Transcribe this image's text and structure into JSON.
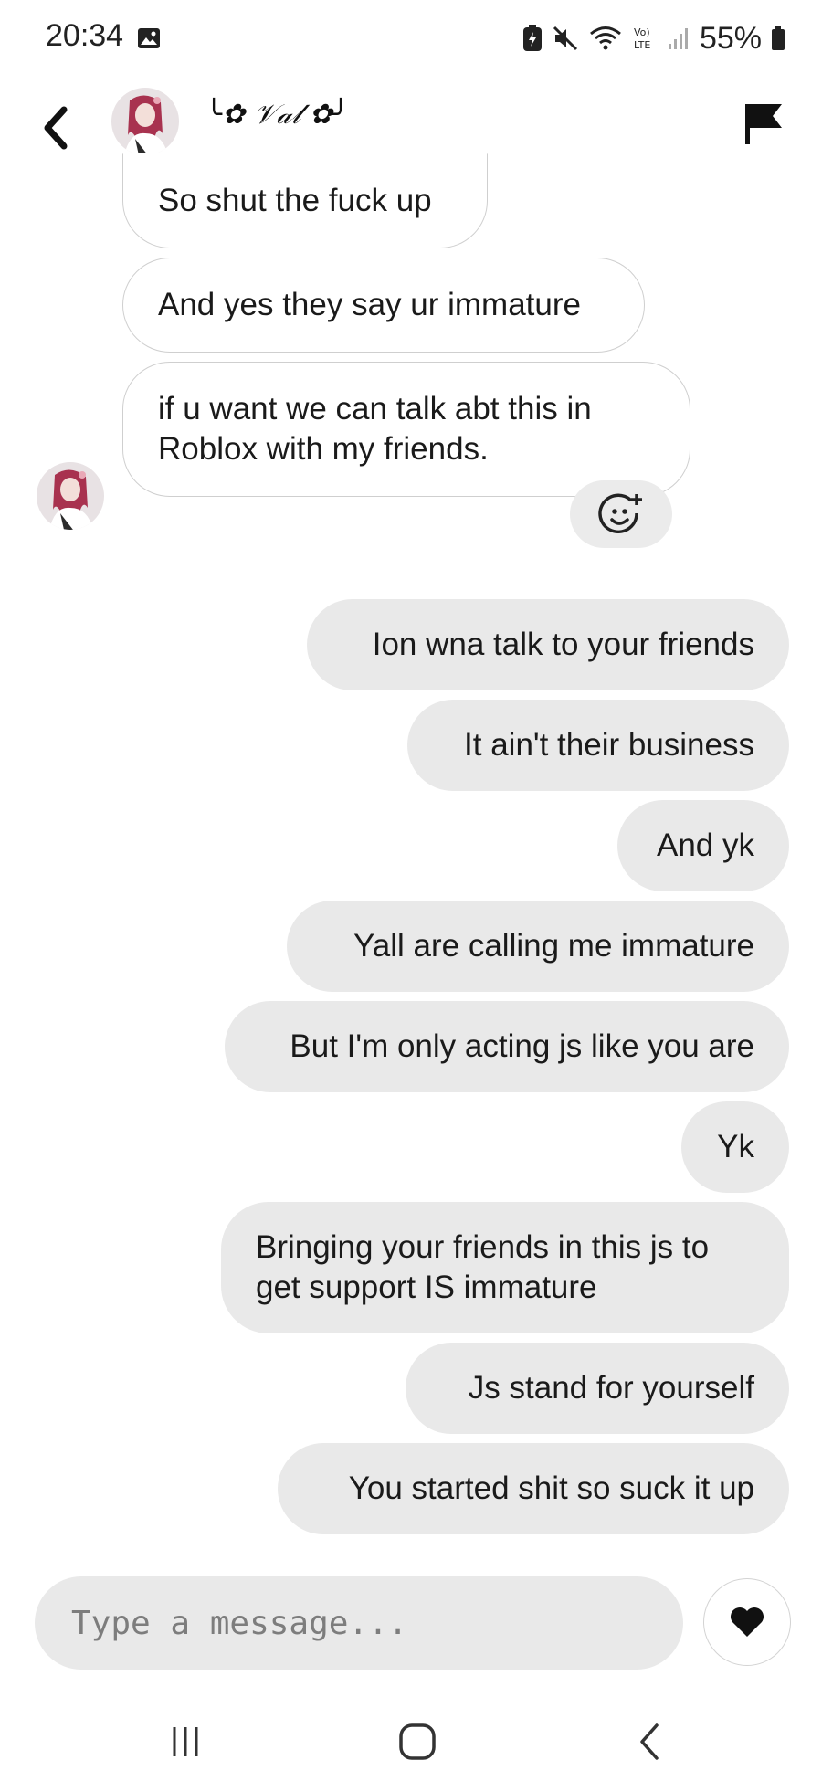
{
  "status_bar": {
    "time": "20:34",
    "battery": "55%",
    "icons": [
      "image-icon",
      "battery-saver-icon",
      "mute-icon",
      "wifi-icon",
      "volte-icon",
      "signal-icon",
      "battery-icon"
    ]
  },
  "header": {
    "contact_name": "╰✿ 𝒱𝒶𝓁 ✿╯",
    "back_icon": "chevron-left-icon",
    "report_icon": "flag-icon"
  },
  "messages": {
    "incoming": [
      "So shut the fuck up",
      "And yes they say ur immature",
      "if u want we can talk abt this in Roblox with my friends."
    ],
    "outgoing": [
      "Ion wna talk to your friends",
      "It ain't their business",
      "And yk",
      "Yall are calling me immature",
      "But I'm only acting js like you are",
      "Yk",
      "Bringing your friends in this js to get support IS immature",
      "Js stand for yourself",
      "You started shit so suck it up"
    ]
  },
  "composer": {
    "placeholder": "Type a message...",
    "send_icon": "heart-icon"
  },
  "nav": {
    "icons": [
      "recents-icon",
      "home-icon",
      "back-icon"
    ]
  },
  "colors": {
    "outgoing_bubble": "#e9e9e9",
    "incoming_border": "#cfcfcf",
    "background": "#ffffff"
  }
}
